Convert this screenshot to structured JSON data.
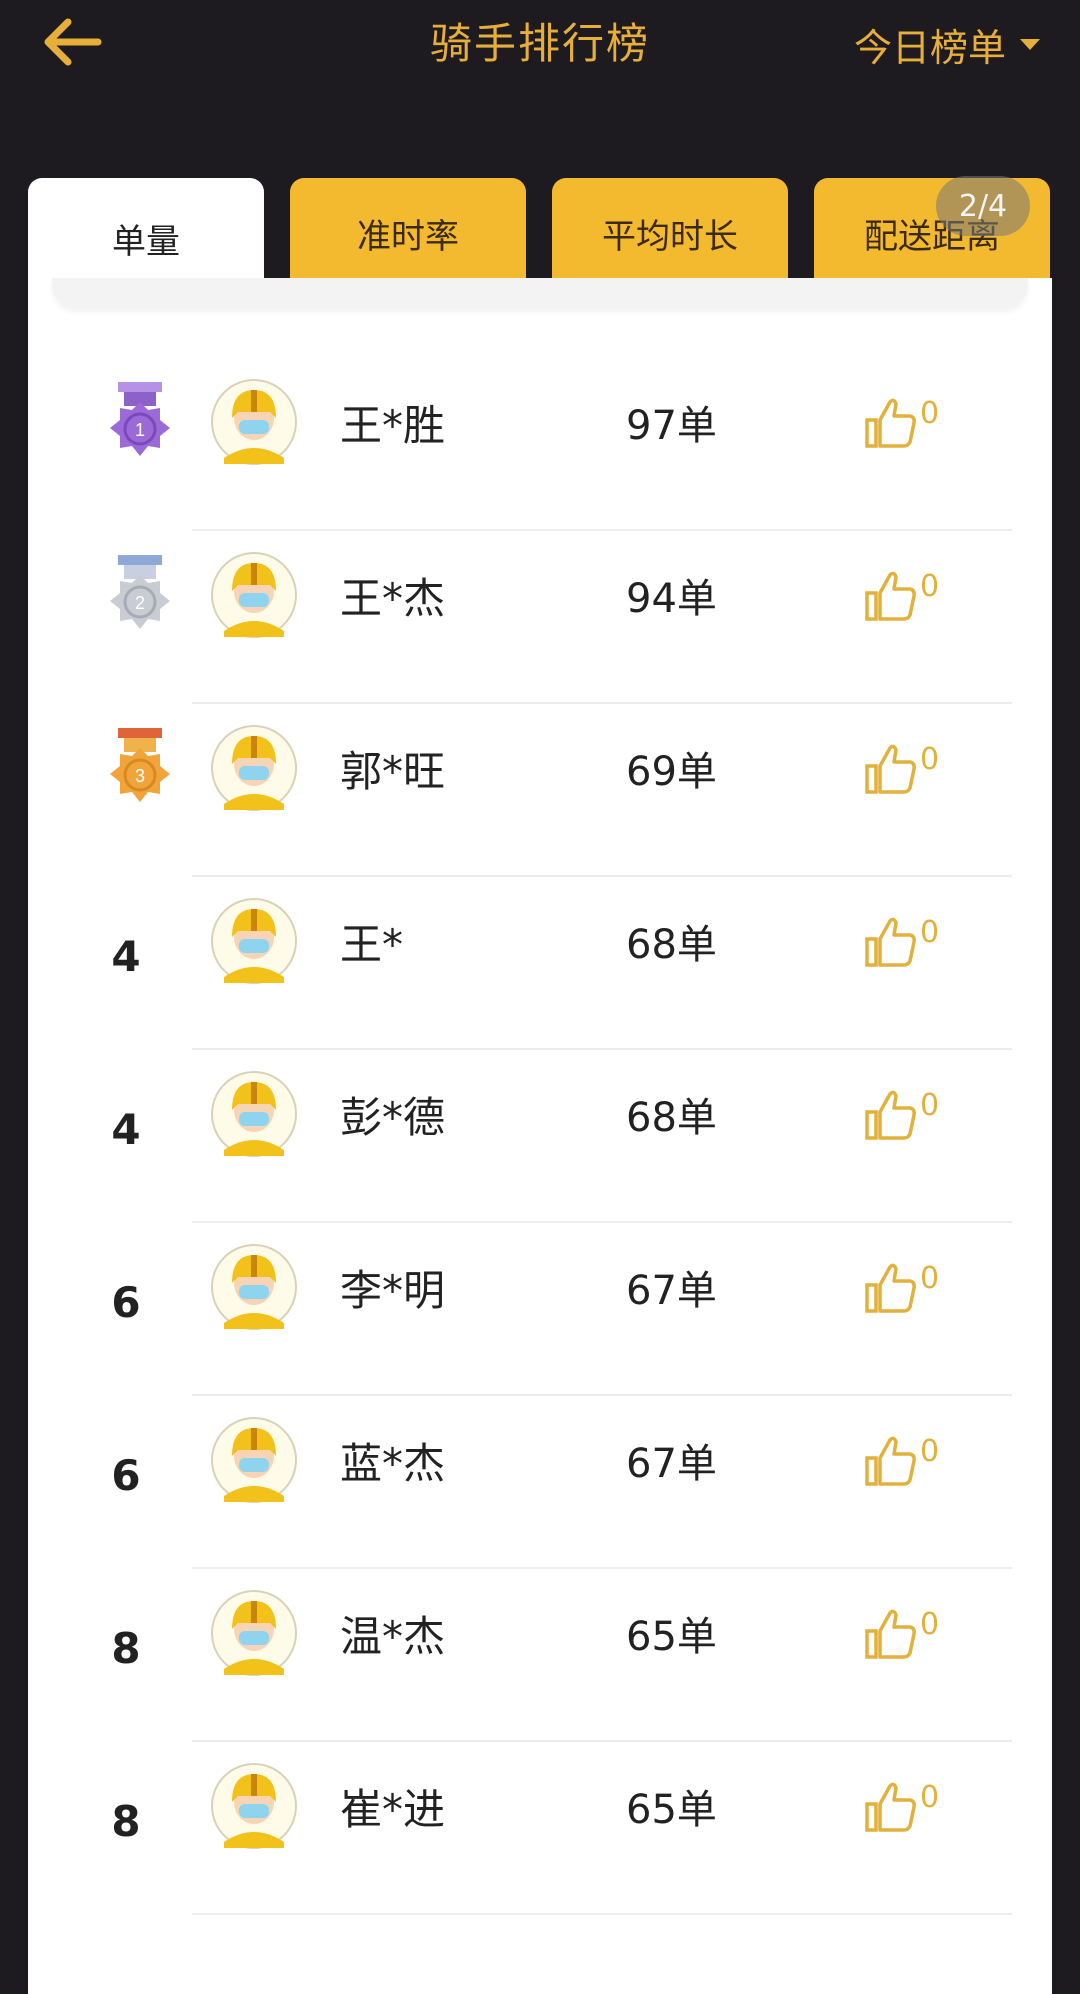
{
  "header": {
    "title": "骑手排行榜",
    "range_label": "今日榜单"
  },
  "tabs": [
    {
      "label": "单量",
      "active": true
    },
    {
      "label": "准时率",
      "active": false
    },
    {
      "label": "平均时长",
      "active": false
    },
    {
      "label": "配送距离",
      "active": false
    }
  ],
  "page_counter": "2/4",
  "colors": {
    "accent": "#e8ae3a",
    "tab_bg": "#f3b92f",
    "background": "#1e1b20"
  },
  "riders": [
    {
      "rank": "1",
      "medal": "gold-medal-icon",
      "name": "王*胜",
      "orders": "97单",
      "likes": "0"
    },
    {
      "rank": "2",
      "medal": "silver-medal-icon",
      "name": "王*杰",
      "orders": "94单",
      "likes": "0"
    },
    {
      "rank": "3",
      "medal": "bronze-medal-icon",
      "name": "郭*旺",
      "orders": "69单",
      "likes": "0"
    },
    {
      "rank": "4",
      "medal": "",
      "name": "王*",
      "orders": "68单",
      "likes": "0"
    },
    {
      "rank": "4",
      "medal": "",
      "name": "彭*德",
      "orders": "68单",
      "likes": "0"
    },
    {
      "rank": "6",
      "medal": "",
      "name": "李*明",
      "orders": "67单",
      "likes": "0"
    },
    {
      "rank": "6",
      "medal": "",
      "name": "蓝*杰",
      "orders": "67单",
      "likes": "0"
    },
    {
      "rank": "8",
      "medal": "",
      "name": "温*杰",
      "orders": "65单",
      "likes": "0"
    },
    {
      "rank": "8",
      "medal": "",
      "name": "崔*进",
      "orders": "65单",
      "likes": "0"
    }
  ]
}
